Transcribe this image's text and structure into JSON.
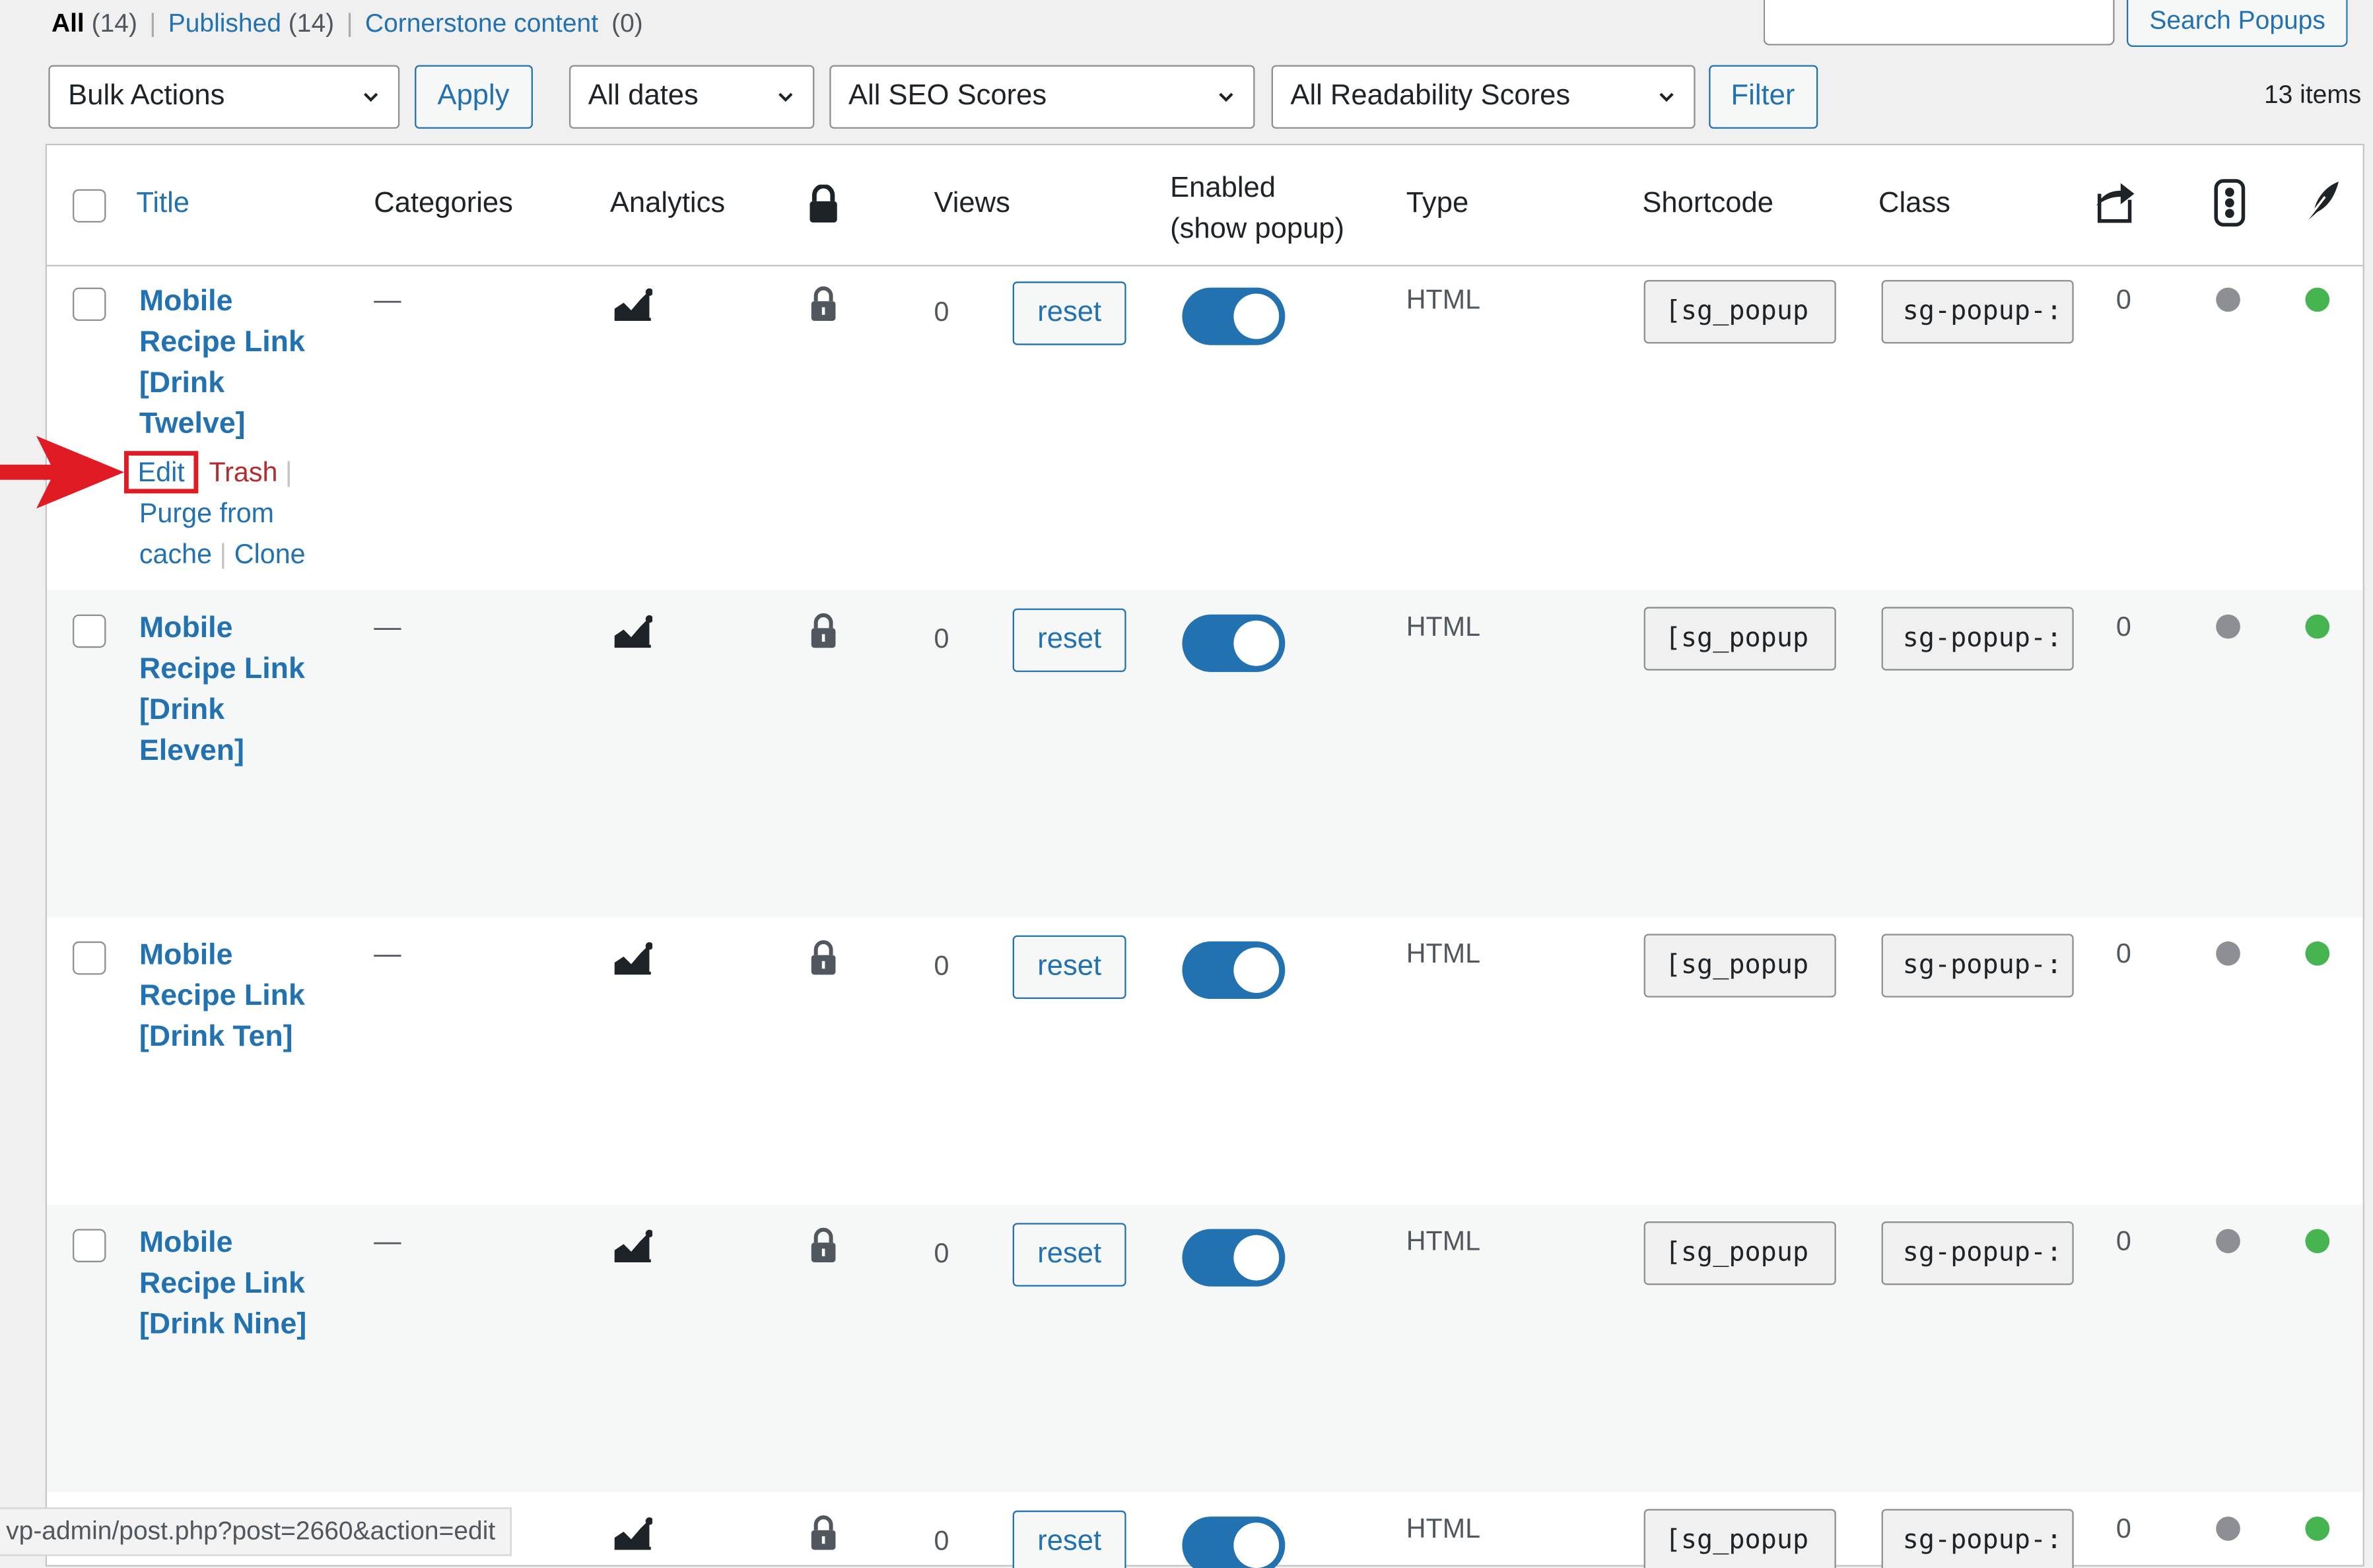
{
  "views": [
    {
      "label": "All",
      "count": "(14)"
    },
    {
      "label": "Published",
      "count": "(14)"
    },
    {
      "label": "Cornerstone content",
      "count": "(0)"
    }
  ],
  "search": {
    "button_label": "Search Popups",
    "value": ""
  },
  "filters": {
    "bulk_actions": "Bulk Actions",
    "apply": "Apply",
    "dates": "All dates",
    "seo": "All SEO Scores",
    "readability": "All Readability Scores",
    "filter": "Filter",
    "items_count": "13 items"
  },
  "columns": {
    "title": "Title",
    "categories": "Categories",
    "analytics": "Analytics",
    "views": "Views",
    "enabled_line1": "Enabled",
    "enabled_line2": "(show popup)",
    "type": "Type",
    "shortcode": "Shortcode",
    "class": "Class"
  },
  "icons": {
    "lock": "lock-icon",
    "analytics": "analytics-chart-icon",
    "share": "share-icon",
    "seo": "seo-traffic-light-icon",
    "readability": "feather-icon"
  },
  "colors": {
    "accent": "#2271b1",
    "trash": "#b32d2e",
    "highlight": "#e01b24",
    "seo_dot": "#8c8f94",
    "readability_dot": "#46b450"
  },
  "rows": [
    {
      "title_lines": [
        "Mobile",
        "Recipe Link",
        "[Drink",
        "Twelve]"
      ],
      "categories": "—",
      "views": "0",
      "reset": "reset",
      "enabled": true,
      "type": "HTML",
      "shortcode": "[sg_popup",
      "class": "sg-popup-:",
      "links": "0"
    },
    {
      "title_lines": [
        "Mobile",
        "Recipe Link",
        "[Drink",
        "Eleven]"
      ],
      "categories": "—",
      "views": "0",
      "reset": "reset",
      "enabled": true,
      "type": "HTML",
      "shortcode": "[sg_popup",
      "class": "sg-popup-:",
      "links": "0"
    },
    {
      "title_lines": [
        "Mobile",
        "Recipe Link",
        "[Drink Ten]"
      ],
      "categories": "—",
      "views": "0",
      "reset": "reset",
      "enabled": true,
      "type": "HTML",
      "shortcode": "[sg_popup",
      "class": "sg-popup-:",
      "links": "0"
    },
    {
      "title_lines": [
        "Mobile",
        "Recipe Link",
        "[Drink Nine]"
      ],
      "categories": "—",
      "views": "0",
      "reset": "reset",
      "enabled": true,
      "type": "HTML",
      "shortcode": "[sg_popup",
      "class": "sg-popup-:",
      "links": "0"
    },
    {
      "title_lines": [],
      "categories": "",
      "views": "0",
      "reset": "reset",
      "enabled": true,
      "type": "HTML",
      "shortcode": "[sg_popup",
      "class": "sg-popup-:",
      "links": "0"
    }
  ],
  "row_actions": {
    "edit": "Edit",
    "trash": "Trash",
    "purge_line1": "Purge from",
    "purge_line2": "cache",
    "clone": "Clone"
  },
  "status_url": "vp-admin/post.php?post=2660&action=edit"
}
